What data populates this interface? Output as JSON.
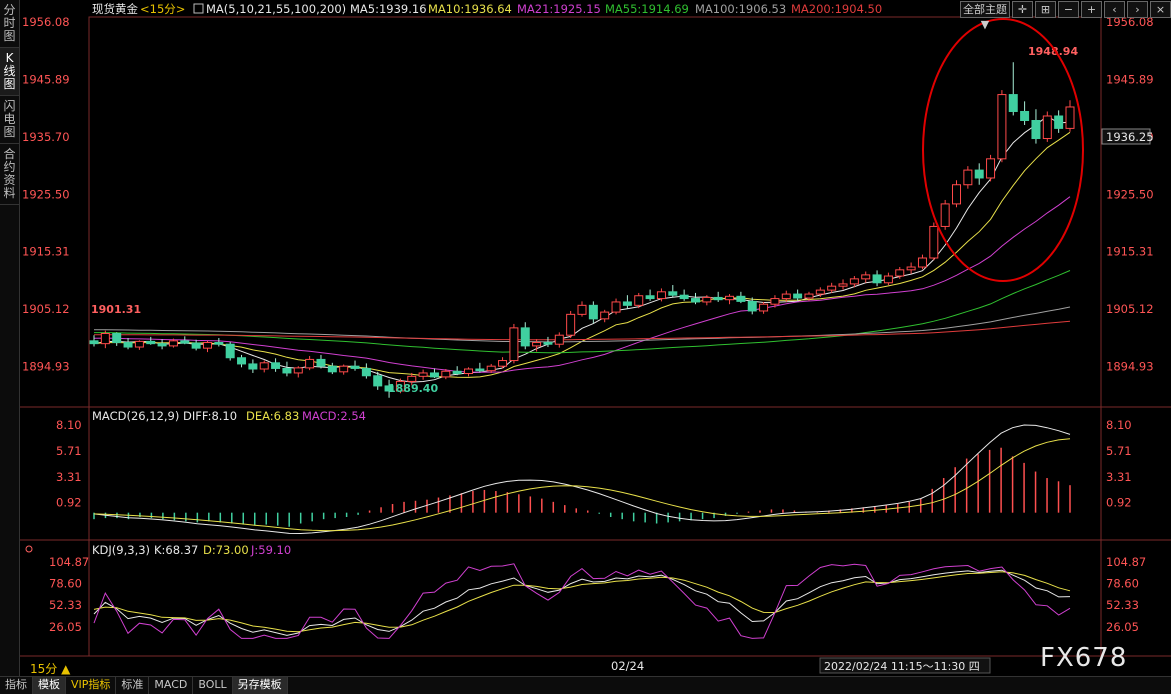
{
  "sidebar": {
    "tabs": [
      {
        "label": "分时图",
        "active": false
      },
      {
        "label": "K线图",
        "active": true
      },
      {
        "label": "闪电图",
        "active": false
      },
      {
        "label": "合约资料",
        "active": false
      }
    ]
  },
  "header": {
    "symbol": "现货黄金",
    "period": "<15分>",
    "ma_label": "MA(5,10,21,55,100,200)",
    "ma_values": [
      {
        "text": "MA5:1939.16",
        "color": "#e8e8e8"
      },
      {
        "text": "MA10:1936.64",
        "color": "#e8e04a"
      },
      {
        "text": "MA21:1925.15",
        "color": "#d040d0"
      },
      {
        "text": "MA55:1914.69",
        "color": "#30c030"
      },
      {
        "text": "MA100:1906.53",
        "color": "#a0a0a0"
      },
      {
        "text": "MA200:1904.50",
        "color": "#e03c3c"
      }
    ],
    "main_dropdown": "全部主题▼"
  },
  "main_panel": {
    "y_ticks": [
      "1956.08",
      "1945.89",
      "1935.70",
      "1925.50",
      "1915.31",
      "1905.12",
      "1894.93"
    ],
    "current_price": "1936.25",
    "high_label": "1948.94",
    "low_label": "1889.40",
    "left_label": "1901.31"
  },
  "macd_panel": {
    "title": "MACD(26,12,9)",
    "diff": "DIFF:8.10",
    "dea": "DEA:6.83",
    "macd": "MACD:2.54",
    "y_ticks": [
      "8.10",
      "5.71",
      "3.31",
      "0.92"
    ]
  },
  "kdj_panel": {
    "title": "KDJ(9,3,3)",
    "k": "K:68.37",
    "d": "D:73.00",
    "j": "J:59.10",
    "y_ticks": [
      "104.87",
      "78.60",
      "52.33",
      "26.05"
    ]
  },
  "x_axis": {
    "date_label": "02/24",
    "cursor_time": "2022/02/24 11:15～11:30 四"
  },
  "bottom_bar": {
    "period": "15分",
    "tabs": [
      "指标",
      "模板",
      "VIP指标",
      "标准",
      "MACD",
      "BOLL",
      "另存模板"
    ]
  },
  "brand": "FX678",
  "colors": {
    "up": "#ff4a4a",
    "down": "#40d0a0",
    "ma5": "#e8e8e8",
    "ma10": "#e8e04a",
    "ma21": "#d040d0",
    "ma55": "#30c030",
    "ma100": "#a0a0a0",
    "ma200": "#e03c3c",
    "axis_red": "#ff5555",
    "annotation_circle": "#e00000"
  },
  "chart_data": {
    "type": "candlestick",
    "price_range": [
      1889,
      1956.08
    ],
    "candles": [
      [
        1899.5,
        1900.5,
        1898.5,
        1899.0
      ],
      [
        1899.0,
        1901.3,
        1898.2,
        1900.8
      ],
      [
        1900.8,
        1901.0,
        1898.6,
        1899.2
      ],
      [
        1899.2,
        1900.0,
        1898.0,
        1898.4
      ],
      [
        1898.4,
        1899.6,
        1897.9,
        1899.4
      ],
      [
        1899.4,
        1900.2,
        1898.8,
        1899.0
      ],
      [
        1899.0,
        1899.8,
        1898.0,
        1898.6
      ],
      [
        1898.6,
        1899.9,
        1898.3,
        1899.5
      ],
      [
        1899.5,
        1900.3,
        1898.9,
        1899.1
      ],
      [
        1899.1,
        1899.7,
        1897.8,
        1898.2
      ],
      [
        1898.2,
        1899.5,
        1897.5,
        1899.2
      ],
      [
        1899.2,
        1900.0,
        1898.5,
        1898.9
      ],
      [
        1898.9,
        1899.3,
        1896.0,
        1896.5
      ],
      [
        1896.5,
        1897.0,
        1894.8,
        1895.4
      ],
      [
        1895.4,
        1896.2,
        1893.8,
        1894.5
      ],
      [
        1894.5,
        1896.0,
        1893.9,
        1895.6
      ],
      [
        1895.6,
        1896.4,
        1894.0,
        1894.6
      ],
      [
        1894.6,
        1895.8,
        1893.2,
        1893.8
      ],
      [
        1893.8,
        1895.0,
        1893.0,
        1894.7
      ],
      [
        1894.7,
        1896.8,
        1894.3,
        1896.2
      ],
      [
        1896.2,
        1897.0,
        1894.6,
        1895.0
      ],
      [
        1895.0,
        1895.6,
        1893.6,
        1894.0
      ],
      [
        1894.0,
        1895.3,
        1893.5,
        1895.0
      ],
      [
        1895.0,
        1896.0,
        1894.2,
        1894.6
      ],
      [
        1894.6,
        1895.5,
        1892.8,
        1893.3
      ],
      [
        1893.3,
        1894.0,
        1890.8,
        1891.5
      ],
      [
        1891.5,
        1892.6,
        1889.4,
        1890.6
      ],
      [
        1890.6,
        1892.8,
        1890.2,
        1892.3
      ],
      [
        1892.3,
        1893.8,
        1891.6,
        1893.2
      ],
      [
        1893.2,
        1894.4,
        1892.6,
        1893.8
      ],
      [
        1893.8,
        1894.6,
        1892.9,
        1893.1
      ],
      [
        1893.1,
        1894.5,
        1892.7,
        1894.1
      ],
      [
        1894.1,
        1895.0,
        1893.4,
        1893.7
      ],
      [
        1893.7,
        1894.8,
        1893.2,
        1894.5
      ],
      [
        1894.5,
        1895.6,
        1893.9,
        1894.2
      ],
      [
        1894.2,
        1895.4,
        1893.8,
        1895.0
      ],
      [
        1895.0,
        1896.6,
        1894.6,
        1896.0
      ],
      [
        1896.0,
        1902.5,
        1895.5,
        1901.8
      ],
      [
        1901.8,
        1902.8,
        1898.0,
        1898.6
      ],
      [
        1898.6,
        1899.8,
        1897.6,
        1899.2
      ],
      [
        1899.2,
        1900.2,
        1898.4,
        1898.9
      ],
      [
        1898.9,
        1901.0,
        1898.3,
        1900.5
      ],
      [
        1900.5,
        1904.8,
        1900.0,
        1904.2
      ],
      [
        1904.2,
        1906.5,
        1903.8,
        1905.8
      ],
      [
        1905.8,
        1906.5,
        1902.6,
        1903.4
      ],
      [
        1903.4,
        1905.0,
        1902.8,
        1904.6
      ],
      [
        1904.6,
        1907.0,
        1904.2,
        1906.4
      ],
      [
        1906.4,
        1907.6,
        1905.2,
        1905.8
      ],
      [
        1905.8,
        1908.0,
        1905.3,
        1907.5
      ],
      [
        1907.5,
        1908.6,
        1906.6,
        1907.0
      ],
      [
        1907.0,
        1908.8,
        1906.5,
        1908.2
      ],
      [
        1908.2,
        1909.4,
        1907.2,
        1907.6
      ],
      [
        1907.6,
        1908.6,
        1906.6,
        1907.0
      ],
      [
        1907.0,
        1908.0,
        1906.0,
        1906.4
      ],
      [
        1906.4,
        1907.6,
        1905.8,
        1907.2
      ],
      [
        1907.2,
        1908.2,
        1906.4,
        1906.8
      ],
      [
        1906.8,
        1907.8,
        1906.0,
        1907.4
      ],
      [
        1907.4,
        1908.2,
        1906.2,
        1906.5
      ],
      [
        1906.5,
        1907.2,
        1904.2,
        1904.8
      ],
      [
        1904.8,
        1906.4,
        1904.3,
        1906.0
      ],
      [
        1906.0,
        1907.6,
        1905.4,
        1907.0
      ],
      [
        1907.0,
        1908.4,
        1906.4,
        1907.8
      ],
      [
        1907.8,
        1908.6,
        1906.6,
        1907.1
      ],
      [
        1907.1,
        1908.2,
        1906.6,
        1907.8
      ],
      [
        1907.8,
        1909.0,
        1907.3,
        1908.5
      ],
      [
        1908.5,
        1909.8,
        1908.0,
        1909.2
      ],
      [
        1909.2,
        1910.4,
        1908.6,
        1909.6
      ],
      [
        1909.6,
        1911.0,
        1909.0,
        1910.5
      ],
      [
        1910.5,
        1911.8,
        1909.8,
        1911.2
      ],
      [
        1911.2,
        1912.0,
        1909.2,
        1909.8
      ],
      [
        1909.8,
        1911.6,
        1909.4,
        1911.0
      ],
      [
        1911.0,
        1912.6,
        1910.5,
        1912.1
      ],
      [
        1912.1,
        1913.4,
        1911.4,
        1912.6
      ],
      [
        1912.6,
        1914.8,
        1912.2,
        1914.2
      ],
      [
        1914.2,
        1920.5,
        1913.8,
        1919.8
      ],
      [
        1919.8,
        1924.5,
        1919.2,
        1923.8
      ],
      [
        1923.8,
        1928.0,
        1923.2,
        1927.2
      ],
      [
        1927.2,
        1930.5,
        1926.5,
        1929.8
      ],
      [
        1929.8,
        1931.0,
        1927.2,
        1928.4
      ],
      [
        1928.4,
        1932.5,
        1927.8,
        1931.8
      ],
      [
        1931.8,
        1944.0,
        1931.2,
        1943.2
      ],
      [
        1943.2,
        1948.94,
        1939.5,
        1940.2
      ],
      [
        1940.2,
        1942.0,
        1937.8,
        1938.6
      ],
      [
        1938.6,
        1940.6,
        1934.5,
        1935.4
      ],
      [
        1935.4,
        1940.2,
        1934.8,
        1939.4
      ],
      [
        1939.4,
        1940.4,
        1936.4,
        1937.2
      ],
      [
        1937.2,
        1942.2,
        1936.6,
        1941.0
      ]
    ],
    "macd_hist": [
      -0.6,
      -0.5,
      -0.5,
      -0.6,
      -0.4,
      -0.5,
      -0.6,
      -0.7,
      -0.8,
      -0.9,
      -0.8,
      -0.9,
      -1.0,
      -1.1,
      -1.2,
      -1.1,
      -1.2,
      -1.3,
      -1.0,
      -0.8,
      -0.6,
      -0.5,
      -0.4,
      -0.2,
      0.2,
      0.5,
      0.8,
      1.0,
      1.1,
      1.2,
      1.4,
      1.6,
      1.8,
      2.0,
      2.1,
      2.0,
      1.9,
      1.7,
      1.5,
      1.3,
      1.0,
      0.7,
      0.4,
      0.2,
      -0.1,
      -0.4,
      -0.6,
      -0.8,
      -0.9,
      -1.0,
      -0.9,
      -0.8,
      -0.7,
      -0.6,
      -0.5,
      -0.3,
      -0.1,
      0.1,
      0.2,
      0.3,
      0.3,
      0.2,
      0.1,
      0.1,
      0.2,
      0.3,
      0.4,
      0.5,
      0.6,
      0.7,
      0.8,
      1.0,
      1.3,
      2.2,
      3.2,
      4.2,
      5.0,
      5.4,
      5.8,
      6.0,
      5.2,
      4.6,
      3.8,
      3.2,
      2.9,
      2.54
    ]
  }
}
